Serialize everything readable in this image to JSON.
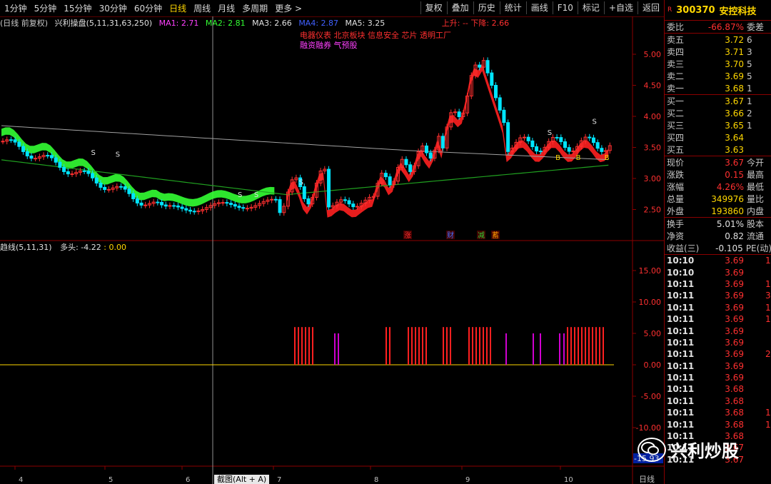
{
  "toolbar": {
    "periods": [
      "1分钟",
      "5分钟",
      "15分钟",
      "30分钟",
      "60分钟",
      "日线",
      "周线",
      "月线",
      "多周期",
      "更多 >"
    ],
    "active_period": "日线",
    "right_buttons": [
      "复权",
      "叠加",
      "历史",
      "统计",
      "画线",
      "F10",
      "标记",
      "+自选",
      "返回"
    ]
  },
  "legend": {
    "title": "(日线 前复权)",
    "indicator": "兴利操盘(5,11,31,63,250)",
    "ma1": "MA1: 2.71",
    "ma2": "MA2: 2.81",
    "ma3": "MA3: 2.66",
    "ma4": "MA4: 2.87",
    "ma5": "MA5: 3.25",
    "up_down": "上升: -- 下降: 2.66",
    "tags1": "电器仪表 北京板块 信息安全 芯片 透明工厂",
    "tags2": "融资融券 气预股"
  },
  "sub_legend": {
    "name": "趋线(5,11,31)",
    "long": "多头: -4.22",
    "val": ": 0.00"
  },
  "main_axis": [
    "5.00",
    "4.50",
    "4.00",
    "3.50",
    "3.00",
    "2.50"
  ],
  "sub_axis": [
    "15.00",
    "10.00",
    "5.00",
    "0.00",
    "-5.00",
    "-10.00"
  ],
  "sub_axis_current": "-15.93",
  "x_axis": [
    "4",
    "5",
    "6",
    "7",
    "8",
    "9",
    "10"
  ],
  "x_axis_right": "日线",
  "tooltip": "截图(Alt + A)",
  "event_tags": [
    "涨",
    "财",
    "减",
    "蓄"
  ],
  "chart_markers": [
    "S",
    "S",
    "S",
    "S",
    "S",
    "S",
    "S",
    "B",
    "B",
    "B"
  ],
  "colors": {
    "up": "#ff3030",
    "down": "#00e5ff",
    "band_up": "#ff2020",
    "band_down": "#33ff33",
    "ma_long": "#20a020",
    "magenta": "#d000d0"
  },
  "quote": {
    "r": "R",
    "code": "300370",
    "name": "安控科技",
    "webi_label": "委比",
    "webi": "-66.87%",
    "weicha_label": "委差",
    "asks": [
      {
        "label": "卖五",
        "price": "3.72",
        "vol": "6"
      },
      {
        "label": "卖四",
        "price": "3.71",
        "vol": "3"
      },
      {
        "label": "卖三",
        "price": "3.70",
        "vol": "5"
      },
      {
        "label": "卖二",
        "price": "3.69",
        "vol": "5"
      },
      {
        "label": "卖一",
        "price": "3.68",
        "vol": "1"
      }
    ],
    "bids": [
      {
        "label": "买一",
        "price": "3.67",
        "vol": "1"
      },
      {
        "label": "买二",
        "price": "3.66",
        "vol": "2"
      },
      {
        "label": "买三",
        "price": "3.65",
        "vol": "1"
      },
      {
        "label": "买四",
        "price": "3.64",
        "vol": ""
      },
      {
        "label": "买五",
        "price": "3.63",
        "vol": ""
      }
    ],
    "stats": [
      {
        "label": "现价",
        "val": "3.67",
        "extra": "今开"
      },
      {
        "label": "涨跌",
        "val": "0.15",
        "extra": "最高"
      },
      {
        "label": "涨幅",
        "val": "4.26%",
        "extra": "最低"
      },
      {
        "label": "总量",
        "val": "349976",
        "extra": "量比"
      },
      {
        "label": "外盘",
        "val": "193860",
        "extra": "内盘"
      }
    ],
    "stats2": [
      {
        "label": "换手",
        "val": "5.01%",
        "extra": "股本"
      },
      {
        "label": "净资",
        "val": "0.82",
        "extra": "流通"
      },
      {
        "label": "收益(三)",
        "val": "-0.105",
        "extra": "PE(动)"
      }
    ],
    "trades": [
      {
        "t": "10:10",
        "p": "3.69",
        "v": "1"
      },
      {
        "t": "10:10",
        "p": "3.69",
        "v": ""
      },
      {
        "t": "10:11",
        "p": "3.69",
        "v": "1"
      },
      {
        "t": "10:11",
        "p": "3.69",
        "v": "3"
      },
      {
        "t": "10:11",
        "p": "3.69",
        "v": "1"
      },
      {
        "t": "10:11",
        "p": "3.69",
        "v": "1"
      },
      {
        "t": "10:11",
        "p": "3.69",
        "v": ""
      },
      {
        "t": "10:11",
        "p": "3.69",
        "v": ""
      },
      {
        "t": "10:11",
        "p": "3.69",
        "v": "2"
      },
      {
        "t": "10:11",
        "p": "3.69",
        "v": ""
      },
      {
        "t": "10:11",
        "p": "3.69",
        "v": ""
      },
      {
        "t": "10:11",
        "p": "3.68",
        "v": ""
      },
      {
        "t": "10:11",
        "p": "3.68",
        "v": ""
      },
      {
        "t": "10:11",
        "p": "3.68",
        "v": "1"
      },
      {
        "t": "10:11",
        "p": "3.68",
        "v": "1"
      },
      {
        "t": "10:11",
        "p": "3.68",
        "v": ""
      },
      {
        "t": "10:11",
        "p": "3.67",
        "v": ""
      },
      {
        "t": "10:11",
        "p": "3.67",
        "v": ""
      }
    ]
  },
  "watermark": "兴利炒股"
}
